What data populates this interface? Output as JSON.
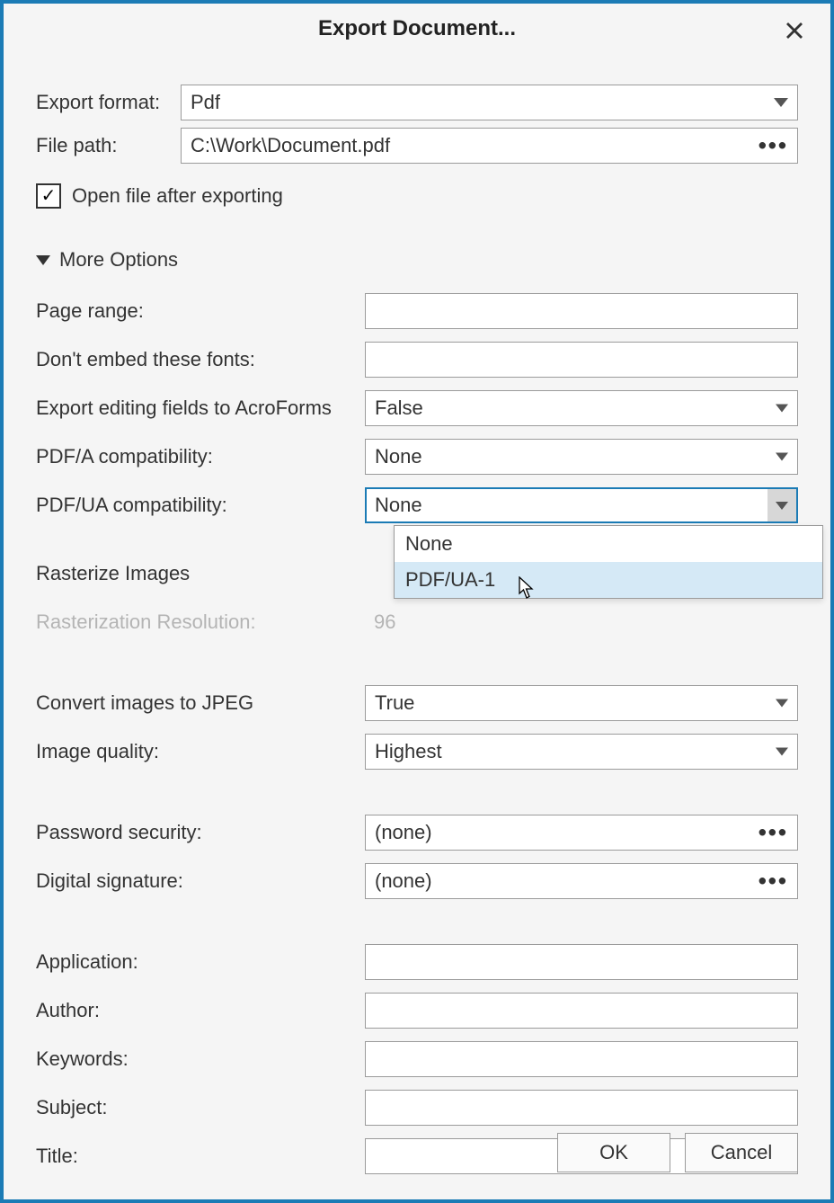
{
  "dialog_title": "Export Document...",
  "labels": {
    "export_format": "Export format:",
    "file_path": "File path:",
    "open_after": "Open file after exporting",
    "more_options": "More Options",
    "page_range": "Page range:",
    "dont_embed": "Don't embed these fonts:",
    "acroforms": "Export editing fields to AcroForms",
    "pdfa": "PDF/A compatibility:",
    "pdfua": "PDF/UA compatibility:",
    "rasterize": "Rasterize Images",
    "raster_res": "Rasterization Resolution:",
    "convert_jpeg": "Convert images to JPEG",
    "img_quality": "Image quality:",
    "password": "Password security:",
    "signature": "Digital signature:",
    "application": "Application:",
    "author": "Author:",
    "keywords": "Keywords:",
    "subject": "Subject:",
    "title": "Title:"
  },
  "values": {
    "export_format": "Pdf",
    "file_path": "C:\\Work\\Document.pdf",
    "open_after_checked": true,
    "page_range": "",
    "dont_embed": "",
    "acroforms": "False",
    "pdfa": "None",
    "pdfua": "None",
    "rasterize": "",
    "raster_res": "96",
    "convert_jpeg": "True",
    "img_quality": "Highest",
    "password": "(none)",
    "signature": "(none)",
    "application": "",
    "author": "",
    "keywords": "",
    "subject": "",
    "title": ""
  },
  "pdfua_dropdown": {
    "option0": "None",
    "option1": "PDF/UA-1"
  },
  "buttons": {
    "ok": "OK",
    "cancel": "Cancel"
  },
  "icons": {
    "checkmark": "✓"
  }
}
